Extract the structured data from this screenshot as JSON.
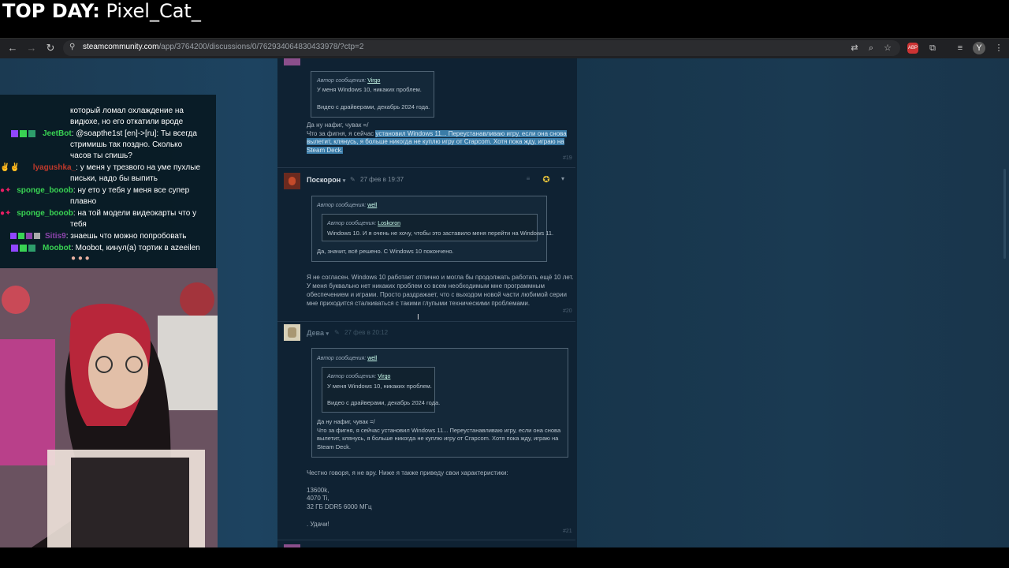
{
  "overlay": {
    "top_day_label": "TOP DAY:",
    "top_day_user": "Pixel_Cat_"
  },
  "browser": {
    "url_host": "steamcommunity.com",
    "url_path": "/app/3764200/discussions/0/762934064830433978/?ctp=2"
  },
  "chat": [
    {
      "user": "",
      "color": "#ffffff",
      "text": "который ломал охлаждение на"
    },
    {
      "user": "",
      "color": "#ffffff",
      "text": "видюхе, но его откатили вроде"
    },
    {
      "user": "JeetBot",
      "color": "#39d353",
      "text": "@soapthe1st [en]->[ru]: Ты всегда"
    },
    {
      "user": "",
      "color": "#ffffff",
      "text": "стримишь так поздно. Сколько"
    },
    {
      "user": "",
      "color": "#ffffff",
      "text": "часов ты спишь?"
    },
    {
      "user": "lyagushka_",
      "color": "#c0392b",
      "text": "у меня у трезвого на уме пухлые"
    },
    {
      "user": "",
      "color": "#ffffff",
      "text": "письки, надо бы выпить"
    },
    {
      "user": "sponge_booob",
      "color": "#39d353",
      "text": "ну ето у тебя у меня все супер"
    },
    {
      "user": "",
      "color": "#ffffff",
      "text": "плавно"
    },
    {
      "user": "sponge_booob",
      "color": "#39d353",
      "text": "на той модели видеокарты что у"
    },
    {
      "user": "",
      "color": "#ffffff",
      "text": "тебя"
    },
    {
      "user": "Sitis9",
      "color": "#8e44ad",
      "text": "знаешь что можно попробовать"
    },
    {
      "user": "Moobot",
      "color": "#39d353",
      "text": "Moobot, кинул(а) тортик в azeeilen"
    }
  ],
  "post1": {
    "quote_author_label": "Автор сообщения:",
    "quote_author": "Virgo",
    "quote_line1": "У меня Windows 10, никаких проблем.",
    "quote_line2": "Видео с драйверами, декабрь 2024 года.",
    "line1": "Да ну нафиг, чувак =/",
    "line2_pre": "Что за фигня, я сейчас ",
    "line2_hl": "установил Windows 11... Переустанавливаю игру, если она снова",
    "line3_hl": "вылетит, клянусь, я больше никогда не куплю игру от Crapcom. Хотя пока жду, играю на",
    "line4_hl": "Steam Deck.",
    "num": "#19"
  },
  "post2": {
    "author": "Поскорон",
    "date": "27 фев в 19:37",
    "outer_author_label": "Автор сообщения:",
    "outer_author": "well",
    "inner_author_label": "Автор сообщения:",
    "inner_author": "Loskoron",
    "inner_text": "Windows 10. И я очень не хочу, чтобы это заставило меня перейти на Windows 11.",
    "outer_text": "Да, значит, всё решено. С Windows 10 покончено.",
    "body1": "Я не согласен. Windows 10 работает отлично и могла бы продолжать работать ещё 10 лет.",
    "body2": "У меня буквально нет никаких проблем со всем необходимым мне программным",
    "body3": "обеспечением и играми. Просто раздражает, что с выходом новой части любимой серии",
    "body4": "мне приходится сталкиваться с такими глупыми техническими проблемами.",
    "num": "#20"
  },
  "post3": {
    "author": "Дева",
    "date": "27 фев в 20:12",
    "outer_author_label": "Автор сообщения:",
    "outer_author": "well",
    "inner_author_label": "Автор сообщения:",
    "inner_author": "Virgo",
    "inner_line1": "У меня Windows 10, никаких проблем.",
    "inner_line2": "Видео с драйверами, декабрь 2024 года.",
    "outer_line1": "Да ну нафиг, чувак =/",
    "outer_line2": "Что за фигня, я сейчас установил Windows 11... Переустанавливаю игру, если она снова",
    "outer_line3": "вылетит, клянусь, я больше никогда не куплю игру от Crapcom. Хотя пока жду, играю на",
    "outer_line4": "Steam Deck.",
    "body1": "Честно говоря, я не вру. Ниже я также приведу свои характеристики:",
    "spec1": "13600k,",
    "spec2": "4070 Ti,",
    "spec3": "32 ГБ DDR5 6000 МГц",
    "body_end": ". Удачи!",
    "num": "#21"
  }
}
